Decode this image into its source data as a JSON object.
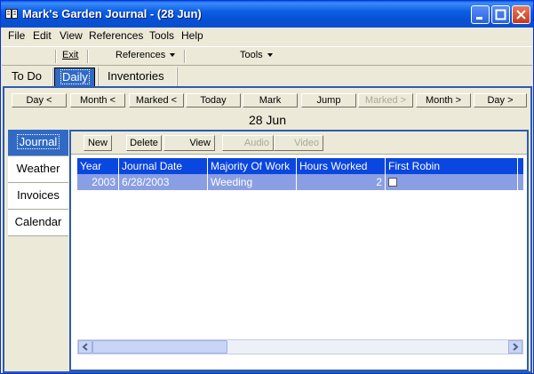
{
  "window": {
    "title": "Mark's Garden Journal - (28 Jun)"
  },
  "menubar": {
    "items": [
      {
        "label": "File"
      },
      {
        "label": "Edit"
      },
      {
        "label": "View"
      },
      {
        "label": "References"
      },
      {
        "label": "Tools"
      },
      {
        "label": "Help"
      }
    ]
  },
  "toolbar": {
    "exit_label": "Exit",
    "references_label": "References",
    "tools_label": "Tools"
  },
  "main_tabs": [
    {
      "label": "To Do"
    },
    {
      "label": "Daily",
      "active": true
    },
    {
      "label": "Inventories"
    }
  ],
  "nav_buttons": [
    {
      "label": "Day <"
    },
    {
      "label": "Month <"
    },
    {
      "label": "Marked <"
    },
    {
      "label": "Today"
    },
    {
      "label": "Mark"
    },
    {
      "label": "Jump"
    },
    {
      "label": "Marked >",
      "disabled": true
    },
    {
      "label": "Month >"
    },
    {
      "label": "Day >"
    }
  ],
  "current_date": "28 Jun",
  "side_tabs": [
    {
      "label": "Journal",
      "active": true
    },
    {
      "label": "Weather"
    },
    {
      "label": "Invoices"
    },
    {
      "label": "Calendar"
    }
  ],
  "journal_toolbar": {
    "new_label": "New",
    "delete_label": "Delete",
    "view_label": "View",
    "audio_label": "Audio",
    "video_label": "Video"
  },
  "grid": {
    "columns": [
      "Year",
      "Journal Date",
      "Majority Of Work",
      "Hours Worked",
      "First Robin"
    ],
    "rows": [
      {
        "year": "2003",
        "journal_date": "6/28/2003",
        "majority_of_work": "Weeding",
        "hours_worked": "2",
        "first_robin": false
      }
    ]
  },
  "colors": {
    "titlebar": "#0a5ce8",
    "selection": "#316ac5",
    "grid_header": "#0a46e0",
    "grid_row": "#8a9fe3"
  }
}
